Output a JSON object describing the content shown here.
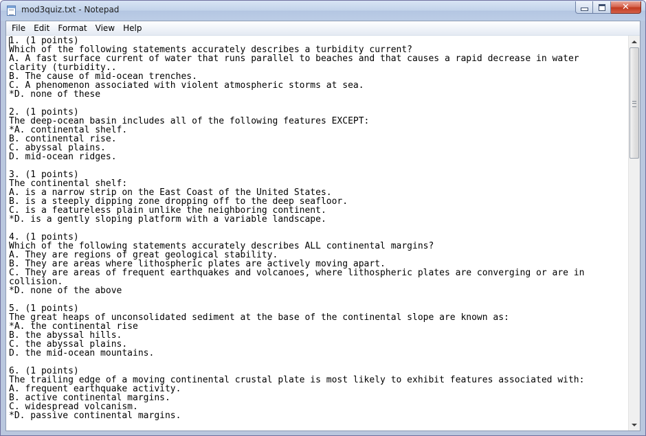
{
  "window": {
    "title": "mod3quiz.txt - Notepad",
    "accent": "#b9c7de",
    "close_color": "#c13b1f"
  },
  "icons": {
    "app": "notepad-icon",
    "minimize": "minimize-icon",
    "maximize": "maximize-icon",
    "close": "close-icon",
    "scroll_up": "arrow-up-icon",
    "scroll_down": "arrow-down-icon"
  },
  "caption": {
    "close_glyph": "✕"
  },
  "menu": {
    "items": [
      "File",
      "Edit",
      "Format",
      "View",
      "Help"
    ]
  },
  "document": {
    "lines": [
      "1. (1 points)",
      "Which of the following statements accurately describes a turbidity current?",
      "A. A fast surface current of water that runs parallel to beaches and that causes a rapid decrease in water",
      "clarity (turbidity..",
      "B. The cause of mid-ocean trenches.",
      "C. A phenomenon associated with violent atmospheric storms at sea.",
      "*D. none of these",
      "",
      "2. (1 points)",
      "The deep-ocean basin includes all of the following features EXCEPT:",
      "*A. continental shelf.",
      "B. continental rise.",
      "C. abyssal plains.",
      "D. mid-ocean ridges.",
      "",
      "3. (1 points)",
      "The continental shelf:",
      "A. is a narrow strip on the East Coast of the United States.",
      "B. is a steeply dipping zone dropping off to the deep seafloor.",
      "C. is a featureless plain unlike the neighboring continent.",
      "*D. is a gently sloping platform with a variable landscape.",
      "",
      "4. (1 points)",
      "Which of the following statements accurately describes ALL continental margins?",
      "A. They are regions of great geological stability.",
      "B. They are areas where lithospheric plates are actively moving apart.",
      "C. They are areas of frequent earthquakes and volcanoes, where lithospheric plates are converging or are in",
      "collision.",
      "*D. none of the above",
      "",
      "5. (1 points)",
      "The great heaps of unconsolidated sediment at the base of the continental slope are known as:",
      "*A. the continental rise",
      "B. the abyssal hills.",
      "C. the abyssal plains.",
      "D. the mid-ocean mountains.",
      "",
      "6. (1 points)",
      "The trailing edge of a moving continental crustal plate is most likely to exhibit features associated with:",
      "A. frequent earthquake activity.",
      "B. active continental margins.",
      "C. widespread volcanism.",
      "*D. passive continental margins."
    ]
  }
}
